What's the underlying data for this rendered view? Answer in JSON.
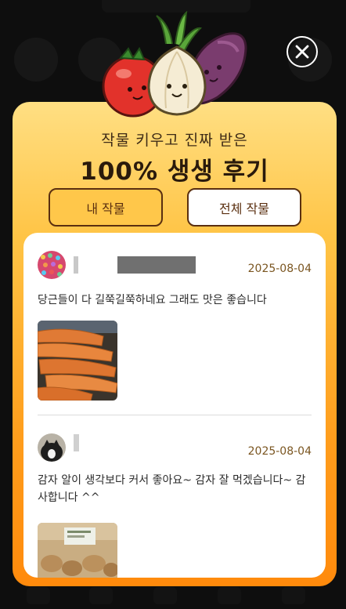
{
  "modal": {
    "subtitle": "작물 키우고 진짜 받은",
    "title": "100% 생생 후기",
    "tabs": [
      {
        "label": "내 작물",
        "active": false
      },
      {
        "label": "전체 작물",
        "active": true
      }
    ]
  },
  "reviews": [
    {
      "date": "2025-08-04",
      "text": "당근들이 다 길쭉길쭉하네요 그래도 맛은 좋습니다",
      "photo_icon": "carrots-photo"
    },
    {
      "date": "2025-08-04",
      "text": "감자 알이 생각보다 커서 좋아요~ 감자 잘 먹겠습니다~ 감사합니다 ^^",
      "photo_icon": "potatoes-photo"
    }
  ],
  "colors": {
    "accent_brown": "#5a2f10",
    "modal_top": "#ffdf83",
    "modal_bottom": "#ff8a0c",
    "date": "#7a5520"
  }
}
